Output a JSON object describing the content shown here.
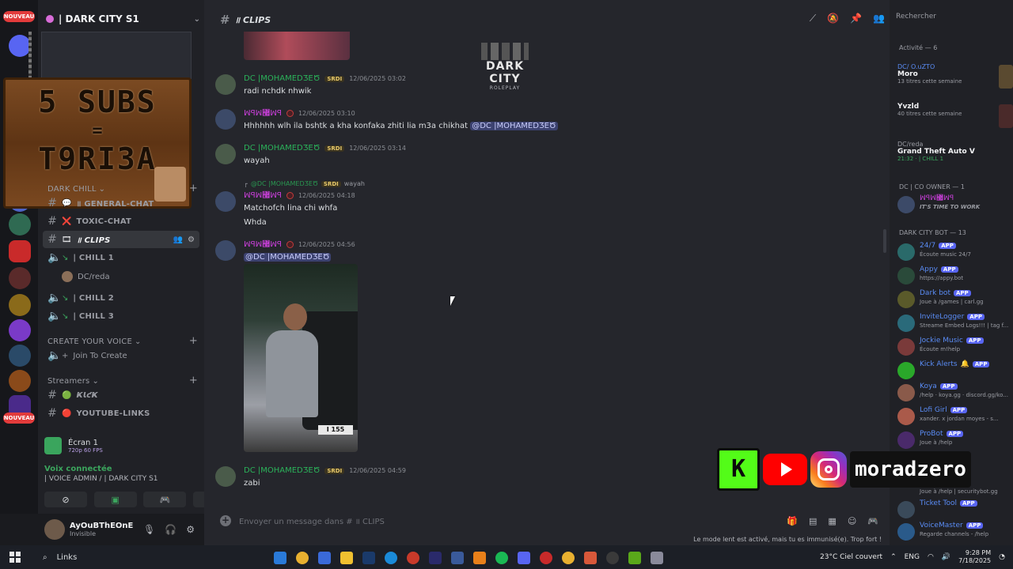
{
  "server": {
    "name": "| DARK CITY S1",
    "nouveau_badge": "NOUVEAU"
  },
  "promo": {
    "line1": "5 SUBS",
    "eq": "=",
    "line2": "T9RI3A"
  },
  "sidebar": {
    "categories": [
      {
        "label": "DARK CHILL"
      },
      {
        "label": "CREATE YOUR VOICE"
      },
      {
        "label": "Streamers"
      }
    ],
    "channels": [
      {
        "icon": "💬",
        "label": "॥ GENERAL-CHAT"
      },
      {
        "icon": "❌",
        "label": "TOXIC-CHAT"
      },
      {
        "icon": "🎞",
        "label": "॥ CLIPS"
      },
      {
        "icon": "↘",
        "label": "| CHILL 1"
      },
      {
        "icon": "↘",
        "label": "| CHILL 2"
      },
      {
        "icon": "↘",
        "label": "| CHILL 3"
      },
      {
        "icon": "+",
        "label": "Join To Create"
      },
      {
        "icon": "🟢",
        "label": "ҜƖƈҜ"
      },
      {
        "icon": "🔴",
        "label": "YOUTUBE-LINKS"
      }
    ],
    "voice_user": "DC/reda"
  },
  "stream_panel": {
    "title": "Écran 1",
    "sub": "720p 60 FPS"
  },
  "voice_connection": {
    "status": "Voix connectée",
    "channel": "| VOICE ADMIN / | DARK CITY S1"
  },
  "user": {
    "name": "AyOuBThEOnE",
    "status": "Invisible"
  },
  "chat": {
    "channel_title": "॥ CLIPS",
    "logo_title": "DARK CITY",
    "logo_sub": "ROLEPLAY",
    "messages": [
      {
        "author": "DC |MOHAMEDƷЕԾ",
        "badge": "SRDI",
        "time": "12/06/2025 03:02",
        "text": "radi nchdk nhwik"
      },
      {
        "author": "ꟽꟼꟽ꟧ꟽꟼ",
        "badge": "",
        "time": "12/06/2025 03:10",
        "text": "Hhhhhh wlh ila bshtk a kha konfaka zhiti lia m3a chikhat",
        "mention": "@DC |MOHAMEDƷЕԾ"
      },
      {
        "author": "DC |MOHAMEDƷЕԾ",
        "badge": "SRDI",
        "time": "12/06/2025 03:14",
        "text": "wayah"
      },
      {
        "author": "ꟽꟼꟽ꟧ꟽꟼ",
        "badge": "",
        "time": "12/06/2025 04:18",
        "text": "Matchofch lina chi whfa",
        "text2": "Whda",
        "reply_author": "@DC |MOHAMEDƷЕԾ",
        "reply_badge": "SRDI",
        "reply_text": "wayah"
      },
      {
        "author": "ꟽꟼꟽ꟧ꟽꟼ",
        "badge": "",
        "time": "12/06/2025 04:56",
        "mention": "@DC |MOHAMEDƷЕԾ",
        "plate": "I 155"
      },
      {
        "author": "DC |MOHAMEDƷЕԾ",
        "badge": "SRDI",
        "time": "12/06/2025 04:59",
        "text": "zabi"
      }
    ],
    "composer_placeholder": "Envoyer un message dans # ॥ CLIPS",
    "slowmode_note": "Le mode lent est activé, mais tu es immunisé(e). Trop fort !"
  },
  "members": {
    "search_placeholder": "Rechercher",
    "activity_header": "Activité — 6",
    "activities": [
      {
        "name": "DC/ O.uZTO",
        "title": "Moro",
        "sub": "13 titres cette semaine"
      },
      {
        "name": "",
        "title": "Yvzld",
        "sub": "40 titres cette semaine"
      },
      {
        "name": "DC/reda",
        "title": "Grand Theft Auto V",
        "sub": "21:32 · | CHILL 1"
      }
    ],
    "co_owner_header": "DC | CO OWNER — 1",
    "co_owner": {
      "name": "ꟽꟼꟽ꟧ꟽꟼ",
      "sub": "IT'S TIME TO WORK"
    },
    "bot_header": "DARK CITY BOT — 13",
    "bots": [
      {
        "name": "24/7",
        "app": "APP",
        "sub": "Écoute music 24/7"
      },
      {
        "name": "Appy",
        "app": "APP",
        "sub": "https://appy.bot"
      },
      {
        "name": "Dark bot",
        "app": "APP",
        "sub": "Joue à /games | carl.gg"
      },
      {
        "name": "InviteLogger",
        "app": "APP",
        "sub": "Streame Embed Logs!!! | tag f..."
      },
      {
        "name": "Jockie Music",
        "app": "APP",
        "sub": "Écoute m!help"
      },
      {
        "name": "Kick Alerts",
        "app": "APP",
        "sub": ""
      },
      {
        "name": "Koya",
        "app": "APP",
        "sub": "/help · koya.gg · discord.gg/ko..."
      },
      {
        "name": "Lofi Girl",
        "app": "APP",
        "sub": "xander. x jordan moyes - s..."
      },
      {
        "name": "ProBot",
        "app": "APP",
        "sub": "Joue à /help"
      },
      {
        "name": "Ticket Tool",
        "app": "APP",
        "sub": ""
      },
      {
        "name": "VoiceMaster",
        "app": "APP",
        "sub": "Regarde channels - /help"
      }
    ],
    "hidden_sub": "Joue à /help | securitybot.gg"
  },
  "overlay": {
    "kick_letter": "K",
    "channel_name": "moradzero"
  },
  "taskbar": {
    "search_label": "Links",
    "weather": "23°C  Ciel couvert",
    "lang": "ENG",
    "time": "9:28 PM",
    "date": "7/18/2025"
  }
}
